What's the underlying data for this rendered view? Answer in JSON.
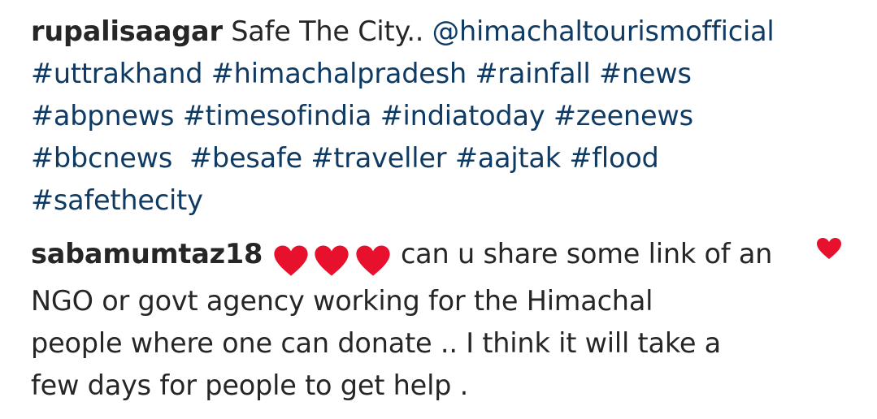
{
  "caption": {
    "username": "rupalisaagar",
    "text": "Safe The City..",
    "mention": "@himachaltourismofficial",
    "hashtags": {
      "uttrakhand": "#uttrakhand",
      "himachalpradesh": "#himachalpradesh",
      "rainfall": "#rainfall",
      "news": "#news",
      "abpnews": "#abpnews",
      "timesofindia": "#timesofindia",
      "indiatoday": "#indiatoday",
      "zeenews": "#zeenews",
      "bbcnews": "#bbcnews",
      "besafe": "#besafe",
      "traveller": "#traveller",
      "aajtak": "#aajtak",
      "flood": "#flood",
      "safethecity": "#safethecity"
    }
  },
  "comment": {
    "username": "sabamumtaz18",
    "emoji_icons": [
      "red-heart-emoji",
      "red-heart-emoji",
      "red-heart-emoji"
    ],
    "lines": [
      "can u share some link of an",
      "NGO or govt agency working for the Himachal",
      "people where one can donate .. I think it will take a",
      "few days for people to get help ."
    ],
    "liked": true,
    "like_icon": "filled-heart-icon",
    "heart_color": "#e8112d"
  },
  "colors": {
    "text": "#262626",
    "hashtag": "#0f3a63"
  }
}
